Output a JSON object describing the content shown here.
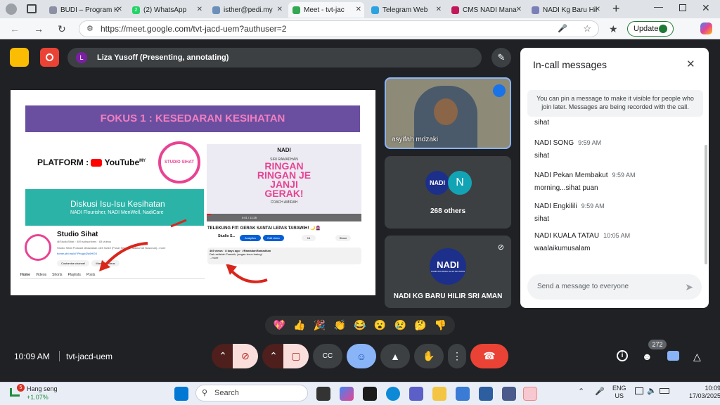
{
  "browser": {
    "tabs": [
      {
        "title": "BUDI – Program K",
        "icon": "web-icon",
        "color": "#8c8fa3"
      },
      {
        "title": "(2) WhatsApp",
        "icon": "whatsapp-icon",
        "color": "#25d366",
        "badge": "2"
      },
      {
        "title": "isther@pedi.my",
        "icon": "mail-icon",
        "color": "#6b8fb8"
      },
      {
        "title": "Meet - tvt-jac",
        "icon": "meet-icon",
        "color": "#34a853",
        "active": true
      },
      {
        "title": "Telegram Web",
        "icon": "telegram-icon",
        "color": "#2aa3e0"
      },
      {
        "title": "CMS NADI Mana",
        "icon": "cms-icon",
        "color": "#c2185b"
      },
      {
        "title": "NADI Kg Baru Hil",
        "icon": "web-icon",
        "color": "#7a7fb8"
      }
    ],
    "url": "https://meet.google.com/tvt-jacd-uem?authuser=2",
    "update_label": "Update"
  },
  "meet": {
    "presenter_initial": "L",
    "presenter_text": "Liza Yusoff (Presenting, annotating)",
    "slide": {
      "heading": "FOKUS 1 : KESEDARAN KESIHATAN",
      "platform_label": "PLATFORM :",
      "youtube_label": "YouTube",
      "youtube_sup": "MY",
      "badge_label": "STUDIO SIHAT",
      "banner_title": "Diskusi Isu-Isu Kesihatan",
      "banner_sub": "NADI Flourisher, NADI MenWell, NadiCare",
      "channel_name": "Studio Sihat",
      "channel_handle": "@StudioSihat · 459 subscribers · 83 videos",
      "channel_desc": "Studio Sihat Podcast dibawakan oleh NADI (Pusat Sebaran Maklumat Nasional)...more",
      "channel_link": "home.pbl.my/c/?Prog/cl2a9HOX",
      "btn_customise": "Customise channel",
      "btn_manage": "Manage videos",
      "channel_tabs": [
        "Home",
        "Videos",
        "Shorts",
        "Playlists",
        "Posts"
      ],
      "video_brand": "NADI",
      "video_series": "SIRI RAMADHAN",
      "video_title_1": "RINGAN",
      "video_title_2": "RINGAN JE",
      "video_title_3": "JANJI",
      "video_title_4": "GERAK!",
      "video_presenter": "COACH AMIRAH",
      "video_time": "0:01 / 11:28",
      "video_caption": "TELEKUNG FIT: GERAK SANTAI LEPAS TARAWIH! 🌙🧕",
      "video_channel": "Studio S...",
      "video_btn_analytics": "Analytics",
      "video_btn_edit": "Edit video",
      "video_like": "16",
      "video_share": "Share",
      "video_meta": "469 views · 8 days ago · #RamadanRamadhan",
      "video_desc": "Dah settelah Tarawih, jangan terus baring!",
      "video_more": "...more"
    },
    "tiles": [
      {
        "name": "asyifah mdzaki"
      },
      {
        "count_label": "268 others",
        "avatar_letter": "N",
        "logo": "NADI"
      },
      {
        "name": "NADI KG BARU HILIR SRI AMAN",
        "logo": "NADI",
        "logo_sub": "KAMPUNG BARU HILIR SRI AMAN"
      }
    ],
    "chat": {
      "title": "In-call messages",
      "info": "You can pin a message to make it visible for people who join later. Messages are being recorded with the call.",
      "partial": "sihat",
      "messages": [
        {
          "sender": "NADI SONG",
          "time": "9:59 AM",
          "text": "sihat"
        },
        {
          "sender": "NADI Pekan Membakut",
          "time": "9:59 AM",
          "text": "morning...sihat puan"
        },
        {
          "sender": "NADI Engkilili",
          "time": "9:59 AM",
          "text": "sihat"
        },
        {
          "sender": "NADI KUALA TATAU",
          "time": "10:05 AM",
          "text": "waalaikumusalam"
        }
      ],
      "input_placeholder": "Send a message to everyone"
    },
    "reactions": [
      "💖",
      "👍",
      "🎉",
      "👏",
      "😂",
      "😮",
      "😢",
      "🤔",
      "👎"
    ],
    "time": "10:09 AM",
    "meeting_code": "tvt-jacd-uem",
    "participants_badge": "272"
  },
  "taskbar": {
    "stock_name": "Hang seng",
    "stock_change": "+1.07%",
    "stock_badge": "5",
    "search_placeholder": "Search",
    "lang_1": "ENG",
    "lang_2": "US",
    "clock_time": "10:09",
    "clock_date": "17/03/2025"
  },
  "colors": {
    "meet_bg": "#202124",
    "tile_bg": "#3c4043",
    "end_call": "#ea4335",
    "muted": "#f9dedc",
    "accent_blue": "#8ab4f8",
    "slide_purple": "#6a4fa0",
    "slide_pink": "#e84393",
    "slide_teal": "#2bb3a8"
  }
}
